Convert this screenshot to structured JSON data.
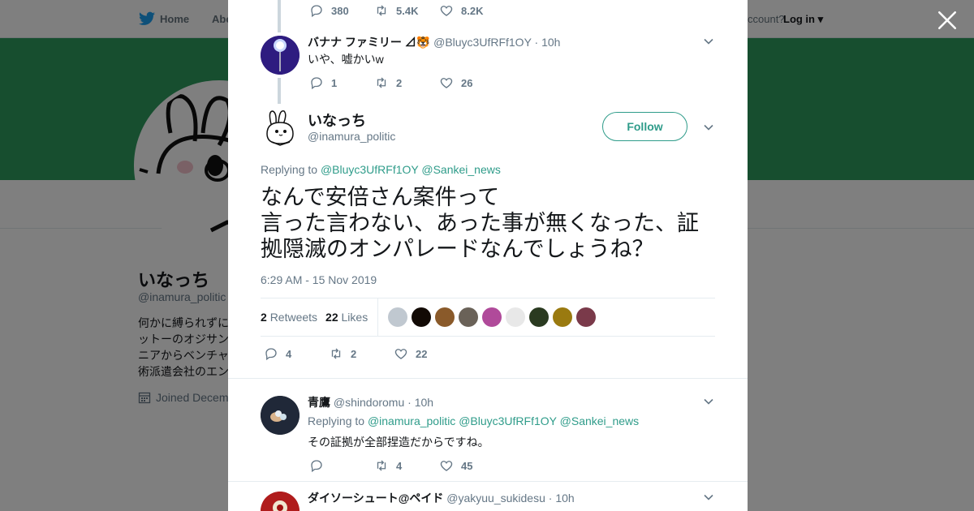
{
  "nav": {
    "home_label": "Home",
    "about_label": "Abo",
    "account_text": "ccount?",
    "login_label": "Log in"
  },
  "profile": {
    "name": "いなっち",
    "handle": "@inamura_politic",
    "bio_lines": [
      "何かに縛られずに",
      "ットーのオジサン",
      "ニアからベンチャ",
      "術派遣会社のエン"
    ],
    "joined": "Joined Decem"
  },
  "colors": {
    "accent": "#2f9c8a",
    "banner": "#2f9c5f"
  },
  "thread": {
    "top_actions": {
      "replies": "380",
      "retweets": "5.4K",
      "likes": "8.2K"
    },
    "prev_tweet": {
      "name": "バナナ ファミリー ⊿🐯",
      "handle": "@Bluyc3UfRFf1OY",
      "time": "10h",
      "text": "いや、嘘かいw",
      "replies": "1",
      "retweets": "2",
      "likes": "26"
    }
  },
  "main_tweet": {
    "name": "いなっち",
    "handle": "@inamura_politic",
    "follow_label": "Follow",
    "replying_prefix": "Replying to",
    "replying_to": [
      "@Bluyc3UfRFf1OY",
      "@Sankei_news"
    ],
    "text": "なんで安倍さん案件って\n言った言わない、あった事が無くなった、証拠隠滅のオンパレードなんでしょうね？",
    "timestamp": "6:29 AM - 15 Nov 2019",
    "retweets_count": "2",
    "retweets_label": "Retweets",
    "likes_count": "22",
    "likes_label": "Likes",
    "replies": "4",
    "retweets": "2",
    "likes": "22"
  },
  "replies": [
    {
      "name": "青鷹",
      "handle": "@shindoromu",
      "time": "10h",
      "replying_prefix": "Replying to",
      "replying_to": [
        "@inamura_politic",
        "@Bluyc3UfRFf1OY",
        "@Sankei_news"
      ],
      "text": "その証拠が全部捏造だからですね。",
      "replies": "",
      "retweets": "4",
      "likes": "45"
    },
    {
      "name": "ダイソーシュート@ペイド",
      "handle": "@yakyuu_sukidesu",
      "time": "10h"
    }
  ]
}
